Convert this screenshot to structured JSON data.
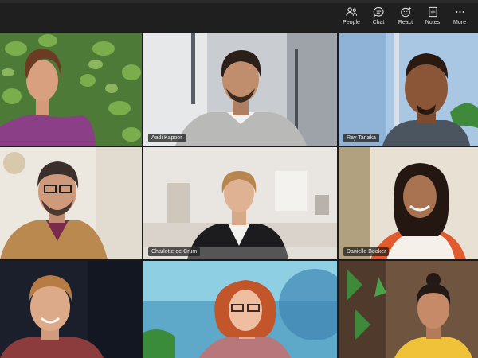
{
  "toolbar": {
    "people": "People",
    "chat": "Chat",
    "react": "React",
    "notes": "Notes",
    "more": "More"
  },
  "participants": [
    {
      "name": ""
    },
    {
      "name": "Aadi Kapoor"
    },
    {
      "name": "Ray Tanaka"
    },
    {
      "name": ""
    },
    {
      "name": "Charlotte de Crum"
    },
    {
      "name": "Danielle Booker"
    },
    {
      "name": ""
    },
    {
      "name": ""
    },
    {
      "name": ""
    }
  ],
  "colors": {
    "toolbar_bg": "#1f1f1f",
    "grid_gap": "#1b1b1b"
  }
}
